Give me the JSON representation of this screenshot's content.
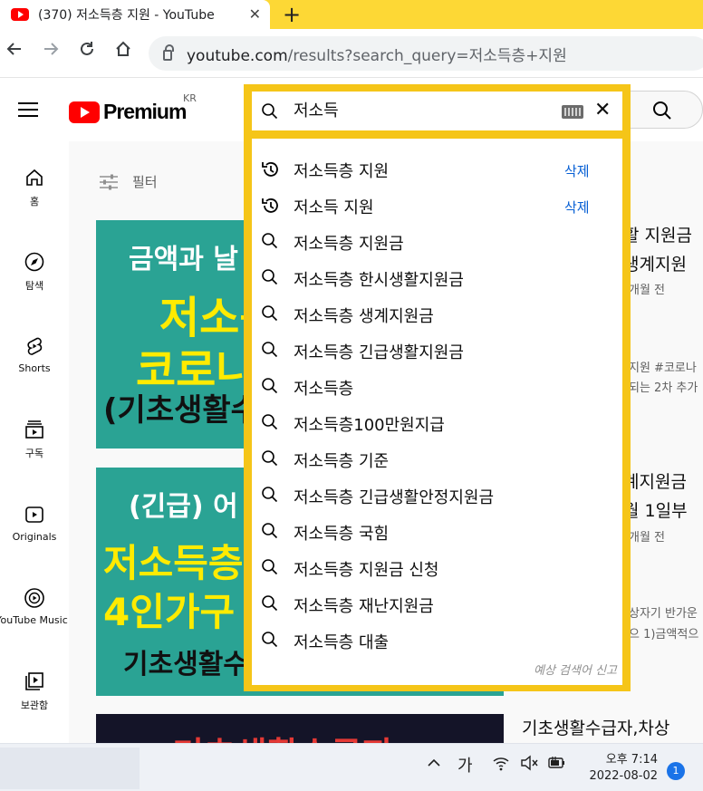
{
  "browser": {
    "tab_title": "(370) 저소득층 지원 - YouTube",
    "tab_close": "✕",
    "new_tab": "+",
    "url_host": "youtube.com",
    "url_path": "/results?search_query=저소득층+지원"
  },
  "header": {
    "logo_text": "Premium",
    "region": "KR"
  },
  "sidebar": {
    "items": [
      {
        "label": "홈",
        "icon": "home-icon"
      },
      {
        "label": "탐색",
        "icon": "explore-icon"
      },
      {
        "label": "Shorts",
        "icon": "shorts-icon"
      },
      {
        "label": "구독",
        "icon": "subscriptions-icon"
      },
      {
        "label": "Originals",
        "icon": "originals-icon"
      },
      {
        "label": "YouTube Music",
        "icon": "music-icon"
      },
      {
        "label": "보관함",
        "icon": "library-icon"
      }
    ]
  },
  "filter": {
    "label": "필터"
  },
  "search": {
    "query": "저소득",
    "suggestions": [
      {
        "text": "저소득층 지원",
        "history": true,
        "delete": "삭제"
      },
      {
        "text": "저소득 지원",
        "history": true,
        "delete": "삭제"
      },
      {
        "text": "저소득층 지원금",
        "history": false
      },
      {
        "text": "저소득층 한시생활지원금",
        "history": false
      },
      {
        "text": "저소득층 생계지원금",
        "history": false
      },
      {
        "text": "저소득층 긴급생활지원금",
        "history": false
      },
      {
        "text": "저소득층",
        "history": false
      },
      {
        "text": "저소득층100만원지급",
        "history": false
      },
      {
        "text": "저소득층 기준",
        "history": false
      },
      {
        "text": "저소득층 긴급생활안정지원금",
        "history": false
      },
      {
        "text": "저소득층 국힘",
        "history": false
      },
      {
        "text": "저소득층 지원금 신청",
        "history": false
      },
      {
        "text": "저소득층 재난지원금",
        "history": false
      },
      {
        "text": "저소득층 대출",
        "history": false
      }
    ],
    "report": "예상 검색어 신고"
  },
  "results": {
    "thumb1_lines": [
      "금액과 날",
      "저소득",
      "코로나",
      "(기초생활수"
    ],
    "thumb2_lines": [
      "(긴급) 어",
      "저소득층",
      "4인가구",
      "기초생활수"
    ],
    "thumb3_line": "기초생활수급자",
    "video1": {
      "title_l1": "활 지원금",
      "title_l2": "생계지원",
      "meta": "개월 전",
      "desc_l1": "지원 #코로나",
      "desc_l2": "되는 2차 추가"
    },
    "video2": {
      "title_l1": "계지원금",
      "title_l2": "월 1일부",
      "meta": "개월 전",
      "desc_l1": "상자기 반가운",
      "desc_l2": "으 1)금액적으"
    },
    "video3": {
      "title_l1": "기초생활수급자,차상"
    }
  },
  "taskbar": {
    "ime": "가",
    "time": "오후 7:14",
    "date": "2022-08-02",
    "notifications": "1"
  }
}
